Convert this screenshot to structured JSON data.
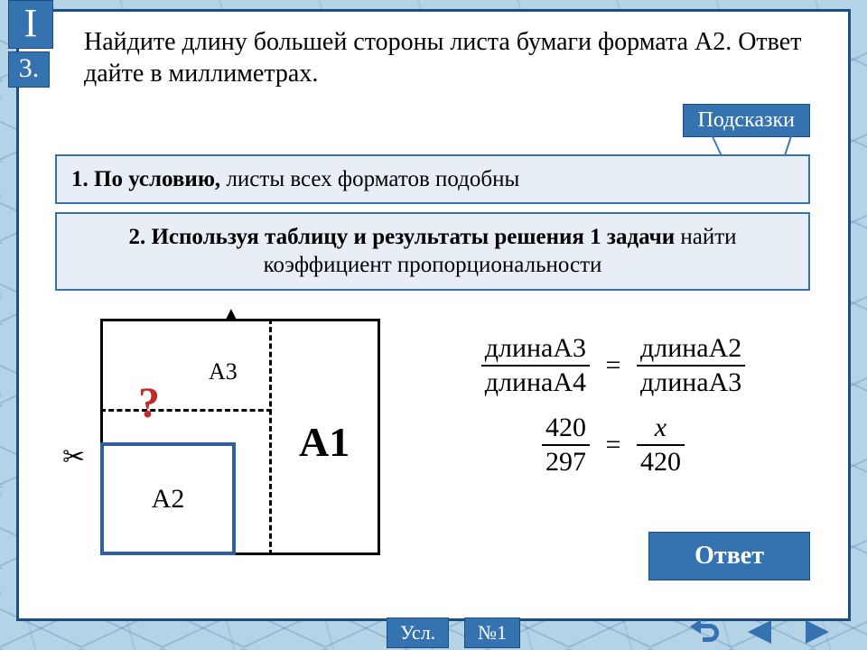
{
  "badge": {
    "letter": "I",
    "number": "3."
  },
  "question": "Найдите длину большей стороны листа бумаги формата А2. Ответ дайте в миллиметрах.",
  "hintButton": "Подсказки",
  "hint1": {
    "bold": "1. По условию,",
    "rest": "  листы всех форматов подобны"
  },
  "hint2": {
    "bold": "2. Используя таблицу и результаты решения 1 задачи",
    "rest": " найти коэффициент пропорциональности"
  },
  "diagram": {
    "a1": "A1",
    "a2": "A2",
    "a3": "A3",
    "question": "?",
    "scissors": "✂"
  },
  "math": {
    "r1": {
      "lt": "длинаА3",
      "lb": "длинаА4",
      "rt": "длинаА2",
      "rb": "длинаА3"
    },
    "r2": {
      "lt": "420",
      "lb": "297",
      "rt": "x",
      "rb": "420"
    },
    "eq": "="
  },
  "answer": "Ответ",
  "nav": {
    "usl": "Усл.",
    "n1": "№1"
  }
}
